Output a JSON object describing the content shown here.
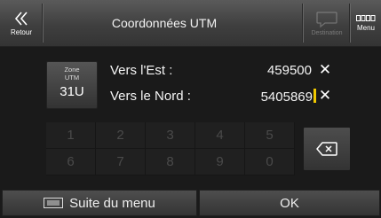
{
  "header": {
    "back_label": "Retour",
    "title": "Coordonnées UTM",
    "destination_label": "Destination",
    "menu_label": "Menu"
  },
  "zone": {
    "label_line1": "Zone",
    "label_line2": "UTM",
    "value": "31U"
  },
  "fields": [
    {
      "label": "Vers l'Est :",
      "value": "459500"
    },
    {
      "label": "Vers le Nord :",
      "value": "5405869"
    }
  ],
  "keypad": {
    "row1": [
      "1",
      "2",
      "3",
      "4",
      "5"
    ],
    "row2": [
      "6",
      "7",
      "8",
      "9",
      "0"
    ]
  },
  "bottom": {
    "more_menu_label": "Suite du menu",
    "ok_label": "OK"
  },
  "colors": {
    "cursor": "#f0c800",
    "disabled_key_text": "#4a4a4a"
  }
}
